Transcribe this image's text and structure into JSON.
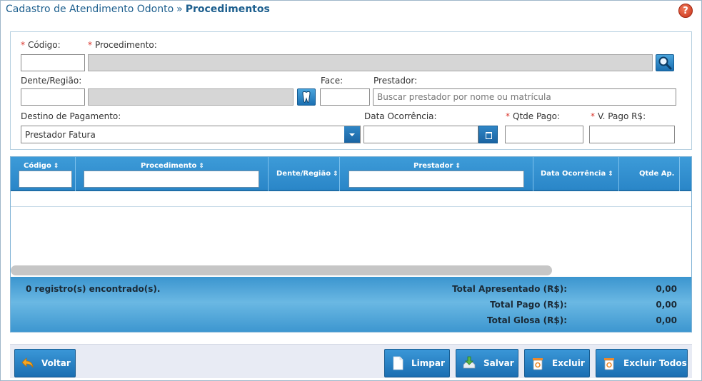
{
  "header": {
    "breadcrumb": "Cadastro de Atendimento Odonto",
    "separator": "»",
    "title": "Procedimentos",
    "help_icon": "?"
  },
  "form": {
    "codigo": {
      "label": "Código:",
      "required_mark": "*",
      "value": ""
    },
    "procedimento": {
      "label": "Procedimento:",
      "required_mark": "*",
      "value": ""
    },
    "dente_regiao": {
      "label": "Dente/Região:",
      "value": ""
    },
    "face": {
      "label": "Face:",
      "value": ""
    },
    "prestador": {
      "label": "Prestador:",
      "placeholder": "Buscar prestador por nome ou matrícula"
    },
    "destino_pagamento": {
      "label": "Destino de Pagamento:",
      "selected": "Prestador Fatura"
    },
    "data_ocorrencia": {
      "label": "Data Ocorrência:",
      "value": ""
    },
    "qtde_pago": {
      "label": "Qtde Pago:",
      "required_mark": "*",
      "value": ""
    },
    "v_pago": {
      "label": "V. Pago R$:",
      "required_mark": "*",
      "value": ""
    }
  },
  "grid": {
    "columns": [
      "Código",
      "Procedimento",
      "Dente/Região",
      "Prestador",
      "Data Ocorrência",
      "Qtde Ap."
    ],
    "sort_icon": "⇕",
    "rows": []
  },
  "footer": {
    "records": "0 registro(s) encontrado(s).",
    "total_apresentado_label": "Total Apresentado (R$):",
    "total_apresentado": "0,00",
    "total_pago_label": "Total Pago (R$):",
    "total_pago": "0,00",
    "total_glosa_label": "Total Glosa (R$):",
    "total_glosa": "0,00"
  },
  "actions": {
    "voltar": "Voltar",
    "limpar": "Limpar",
    "salvar": "Salvar",
    "excluir": "Excluir",
    "excluir_todos": "Excluir Todos"
  },
  "icons": {
    "search": "magnifier-icon",
    "tooth": "tooth-icon",
    "calendar": "calendar-icon",
    "back": "back-arrow-icon",
    "clear": "document-icon",
    "save": "download-tray-icon",
    "delete": "recycle-bin-icon"
  },
  "colors": {
    "accent": "#2a86c8",
    "title": "#1d5f8e",
    "required": "#d9342b"
  }
}
